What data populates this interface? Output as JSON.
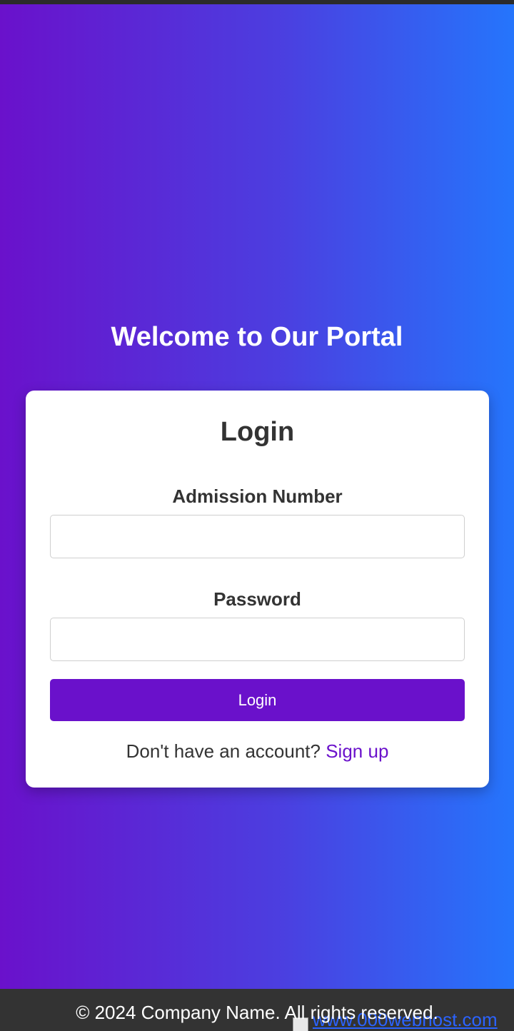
{
  "header": {
    "title": "Welcome to Our Portal"
  },
  "login_form": {
    "title": "Login",
    "admission_label": "Admission Number",
    "admission_value": "",
    "password_label": "Password",
    "password_value": "",
    "submit_label": "Login",
    "signup_prompt": "Don't have an account?",
    "signup_link": "Sign up"
  },
  "footer": {
    "copyright": "© 2024 Company Name. All rights reserved.",
    "hosting_link": "www.000webhost.com",
    "hosting_icon": "broken-image-icon"
  },
  "colors": {
    "gradient_start": "#6a11cb",
    "gradient_end": "#2575fc",
    "accent": "#6a11cb",
    "footer_bg": "#333333"
  }
}
